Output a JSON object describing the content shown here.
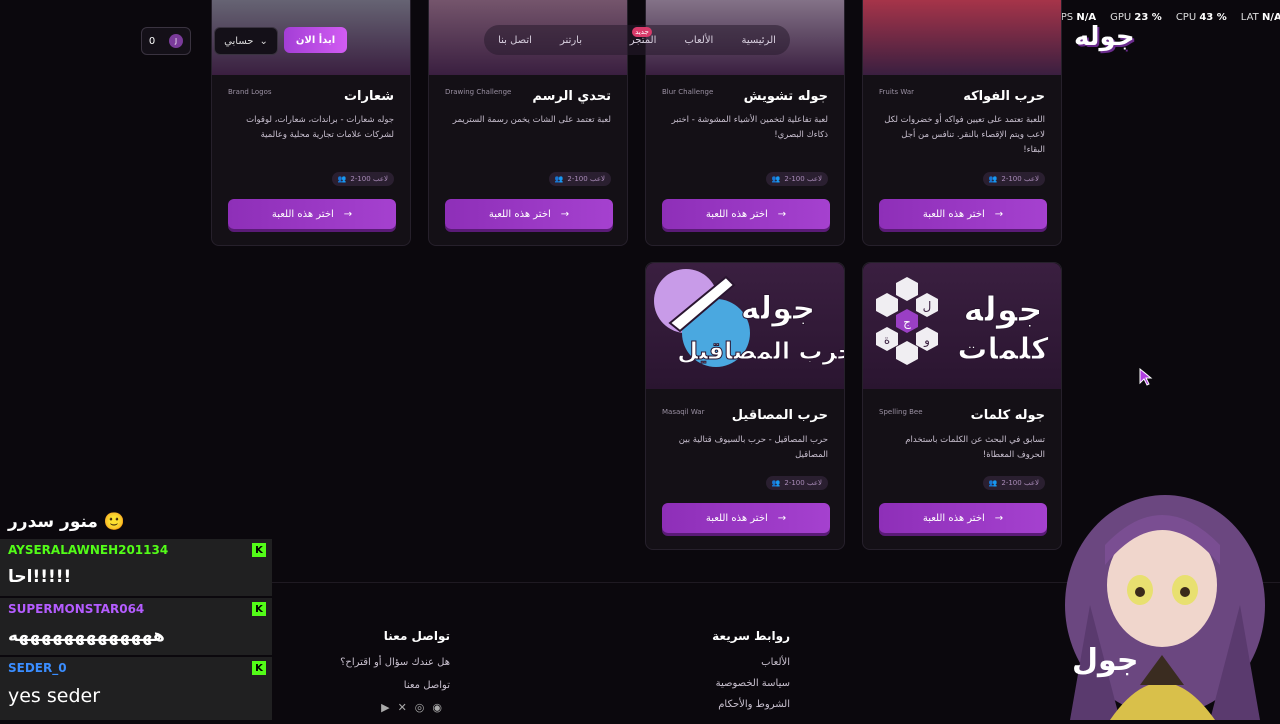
{
  "stats": {
    "fps_label": "FPS",
    "fps_value": "N/A",
    "gpu_label": "GPU",
    "gpu_value": "23 %",
    "cpu_label": "CPU",
    "cpu_value": "43 %",
    "lat_label": "LAT",
    "lat_value": "N/A"
  },
  "header": {
    "logo": "جوله",
    "nav": [
      "الرئيسية",
      "الألعاب",
      "المتجر",
      "بارتنر",
      "اتصل بنا"
    ],
    "new_badge": "جديد",
    "start_button": "ابدأ الان",
    "account_button": "حسابي",
    "coins": "0",
    "coin_icon": "J"
  },
  "games": [
    {
      "title": "حرب الفواكه",
      "tag": "Fruits War",
      "desc": "اللعبة تعتمد على تعيين فواكه أو خضروات لكل لاعب ويتم الإقصاء بالنقر. تنافس من أجل البقاء!",
      "players": "2-100 لاعب",
      "button": "اختر هذه اللعبة"
    },
    {
      "title": "جوله تشويش",
      "tag": "Blur Challenge",
      "desc": "لعبة تفاعلية لتخمين الأشياء المشوشة - اختبر ذكاءك البصري!",
      "players": "2-100 لاعب",
      "button": "اختر هذه اللعبة"
    },
    {
      "title": "تحدي الرسم",
      "tag": "Drawing Challenge",
      "desc": "لعبة تعتمد على الشات يخمن رسمة الستريمر",
      "players": "2-100 لاعب",
      "button": "اختر هذه اللعبة"
    },
    {
      "title": "شعارات",
      "tag": "Brand Logos",
      "desc": "جوله شعارات - براندات، شعارات، لوقوات لشركات علامات تجارية محلية وعالمية",
      "players": "2-100 لاعب",
      "button": "اختر هذه اللعبة"
    },
    {
      "title": "جوله كلمات",
      "tag": "Spelling Bee",
      "desc": "تسابق في البحث عن الكلمات باستخدام الحروف المعطاة!",
      "players": "2-100 لاعب",
      "button": "اختر هذه اللعبة",
      "art_line1": "جوله",
      "art_line2": "كلمات",
      "hex_letters": [
        "ل",
        "ج",
        "و",
        "ة"
      ]
    },
    {
      "title": "حرب المصاقيل",
      "tag": "Masaqil War",
      "desc": "حرب المصاقيل - حرب بالسيوف قتالية بين المصاقيل",
      "players": "2-100 لاعب",
      "button": "اختر هذه اللعبة",
      "art_line1": "جوله",
      "art_line2": "حرب المصاقيل"
    }
  ],
  "chat": {
    "top_message": "منور سدرر",
    "messages": [
      {
        "user": "AYSERALAWNEH201134",
        "text": "احا!!!!!",
        "color": "#53fc18"
      },
      {
        "user": "SUPERMONSTAR064",
        "text": "هههههههههههههه",
        "color": "#b45cff"
      },
      {
        "user": "SEDER_0",
        "text": "yes seder",
        "color": "#3a8dff"
      }
    ],
    "platform_icon": "K"
  },
  "footer": {
    "contact_title": "تواصل معنا",
    "contact_q": "هل عندك سؤال أو اقتراح؟",
    "contact_link": "تواصل معنا",
    "links_title": "روابط سريعة",
    "links": [
      "الألعاب",
      "سياسة الخصوصية",
      "الشروط والأحكام"
    ]
  },
  "overlay": {
    "logo": "جول"
  },
  "colors": {
    "accent": "#a541cf",
    "bg": "#0b080d",
    "card": "#141016"
  }
}
